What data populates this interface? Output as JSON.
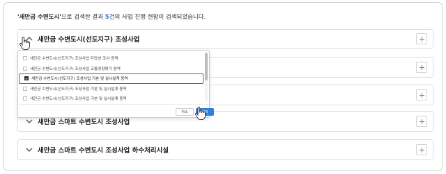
{
  "summary": {
    "keyword": "'새만금 수변도시'",
    "text1": "으로 검색한 결과 ",
    "count": "5",
    "text2": "건의 사업 진행 현황이 검색되었습니다."
  },
  "panels": [
    {
      "title": "새만금 수변도시(선도지구) 조성사업",
      "expanded": true
    },
    {
      "title": "",
      "expanded": false
    },
    {
      "title": "",
      "expanded": false
    },
    {
      "title": "새만금 스마트 수변도시 조성사업",
      "expanded": false
    },
    {
      "title": "새만금 스마트 수변도시 조성사업 하수처리시설",
      "expanded": false
    }
  ],
  "dropdown": {
    "options": [
      {
        "label": "새만금 수변도시(선도지구) 조성사업 타당성 조사 용역",
        "checked": false
      },
      {
        "label": "새만금 수변도시(선도지구) 조성사업 교통영향평가 용역",
        "checked": false
      },
      {
        "label": "새만금 수변도시(선도지구) 조성사업 기본 및 실시설계 용역",
        "checked": true
      },
      {
        "label": "새만금 수변도시(선도지구) 조성사업 기본 및 실시설계 용역",
        "checked": false
      },
      {
        "label": "새만금 수변도시(선도지구) 조성사업 기본 및 실시설계 용역",
        "checked": false
      }
    ],
    "cancel_label": "취소",
    "add_label": "제외"
  },
  "icons": {
    "chevron": "chevron-down-icon",
    "plus": "plus-icon",
    "cursor": "hand-pointer-icon",
    "check": "check-icon"
  },
  "colors": {
    "accent": "#2f7de1",
    "selected_outline": "#2b6cc4",
    "border": "#dcdcdc"
  }
}
